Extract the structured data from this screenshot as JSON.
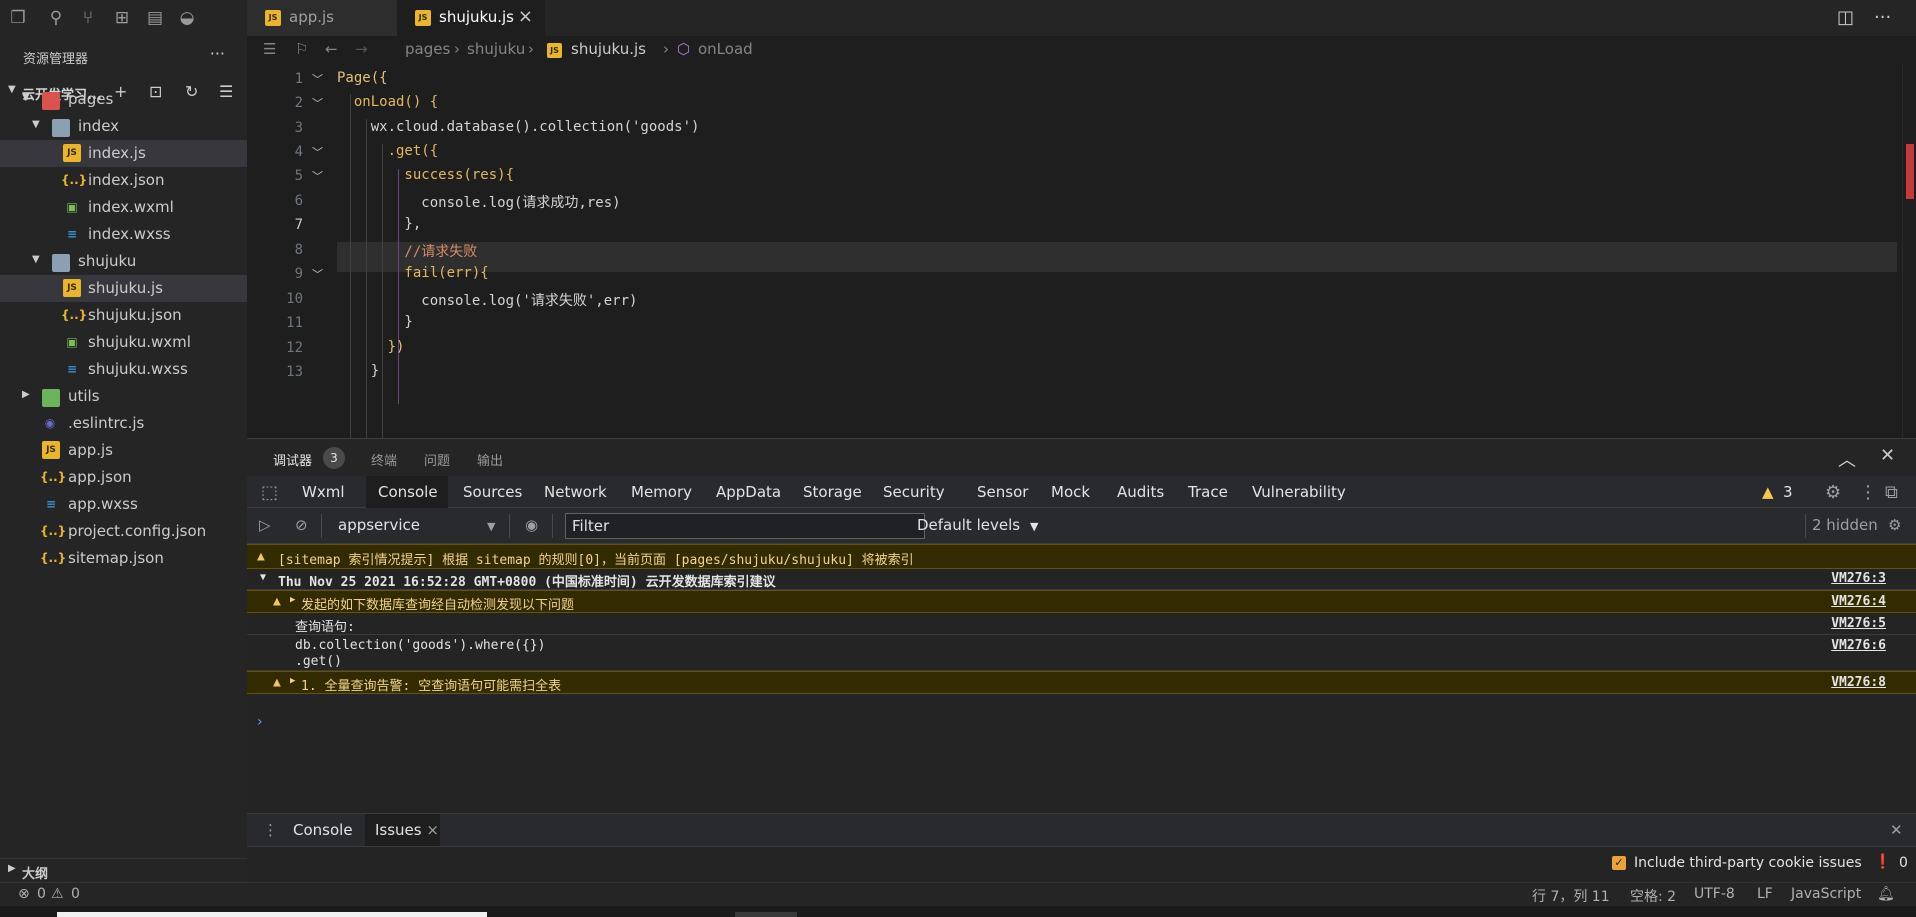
{
  "activity": {
    "icons": [
      "files-icon",
      "search-icon",
      "source-control-icon",
      "extensions-icon",
      "layout-icon",
      "docker-icon"
    ]
  },
  "sidebar": {
    "title": "资源管理器",
    "more": "···",
    "project_label": "云开发学习...",
    "tree": [
      {
        "name": "pages",
        "type": "folder-special"
      },
      {
        "name": "index",
        "type": "folder"
      },
      {
        "name": "index.js",
        "type": "js",
        "selected": true
      },
      {
        "name": "index.json",
        "type": "json"
      },
      {
        "name": "index.wxml",
        "type": "wxml"
      },
      {
        "name": "index.wxss",
        "type": "wxss"
      },
      {
        "name": "shujuku",
        "type": "folder"
      },
      {
        "name": "shujuku.js",
        "type": "js",
        "selected": true
      },
      {
        "name": "shujuku.json",
        "type": "json"
      },
      {
        "name": "shujuku.wxml",
        "type": "wxml"
      },
      {
        "name": "shujuku.wxss",
        "type": "wxss"
      },
      {
        "name": "utils",
        "type": "folder-green"
      },
      {
        "name": ".eslintrc.js",
        "type": "eslint"
      },
      {
        "name": "app.js",
        "type": "js"
      },
      {
        "name": "app.json",
        "type": "json"
      },
      {
        "name": "app.wxss",
        "type": "wxss"
      },
      {
        "name": "project.config.json",
        "type": "json"
      },
      {
        "name": "sitemap.json",
        "type": "json"
      }
    ],
    "outline": "大纲"
  },
  "tabs": [
    {
      "label": "app.js",
      "active": false
    },
    {
      "label": "shujuku.js",
      "active": true
    }
  ],
  "breadcrumb": {
    "parts": [
      "pages",
      "shujuku",
      "shujuku.js",
      "onLoad"
    ]
  },
  "code": {
    "current_line": 7,
    "lines": [
      {
        "n": "1",
        "text": "Page({"
      },
      {
        "n": "2",
        "text": "  onLoad() {"
      },
      {
        "n": "3",
        "text": "    wx.cloud.database().collection('goods')"
      },
      {
        "n": "4",
        "text": "      .get({"
      },
      {
        "n": "5",
        "text": "        success(res){"
      },
      {
        "n": "6",
        "text": "          console.log(请求成功,res)"
      },
      {
        "n": "7",
        "text": "        },"
      },
      {
        "n": "8",
        "text": "        //请求失败"
      },
      {
        "n": "9",
        "text": "        fail(err){"
      },
      {
        "n": "10",
        "text": "          console.log('请求失败',err)"
      },
      {
        "n": "11",
        "text": "        }"
      },
      {
        "n": "12",
        "text": "      })"
      },
      {
        "n": "13",
        "text": "    }"
      }
    ]
  },
  "panel": {
    "tabs": [
      "调试器",
      "终端",
      "问题",
      "输出"
    ],
    "badge": "3"
  },
  "devtools": {
    "tabs": [
      "Wxml",
      "Console",
      "Sources",
      "Network",
      "Memory",
      "AppData",
      "Storage",
      "Security",
      "Sensor",
      "Mock",
      "Audits",
      "Trace",
      "Vulnerability"
    ],
    "active_tab": "Console",
    "warn_count": "3",
    "context": "appservice",
    "filter_placeholder": "Filter",
    "levels": "Default levels",
    "hidden": "2 hidden"
  },
  "console": {
    "messages": [
      {
        "text": "[sitemap 索引情况提示] 根据 sitemap 的规则[0]，当前页面 [pages/shujuku/shujuku] 将被索引",
        "src": "",
        "kind": "warn"
      },
      {
        "text": "Thu Nov 25 2021 16:52:28 GMT+0800 (中国标准时间) 云开发数据库索引建议",
        "src": "VM276:3",
        "kind": "group"
      },
      {
        "text": "发起的如下数据库查询经自动检测发现以下问题",
        "src": "VM276:4",
        "kind": "warn"
      },
      {
        "text": "查询语句:",
        "src": "VM276:5",
        "kind": "log"
      },
      {
        "text": "db.collection('goods').where({})",
        "text2": ".get()",
        "src": "VM276:6",
        "kind": "log"
      },
      {
        "text": "1. 全量查询告警: 空查询语句可能需扫全表",
        "src": "VM276:8",
        "kind": "warn"
      }
    ],
    "prompt": "›"
  },
  "drawer": {
    "tabs": [
      "Console",
      "Issues"
    ],
    "active": "Issues",
    "third_party": "Include third-party cookie issues",
    "issue_count": "0"
  },
  "status": {
    "errors": "0",
    "warnings": "0",
    "position": "行 7，列 11",
    "spaces": "空格: 2",
    "encoding": "UTF-8",
    "eol": "LF",
    "language": "JavaScript"
  },
  "colors": {
    "accent": "#e8b52b",
    "warn_bg": "#332b00",
    "link": "#4ea1ff"
  }
}
